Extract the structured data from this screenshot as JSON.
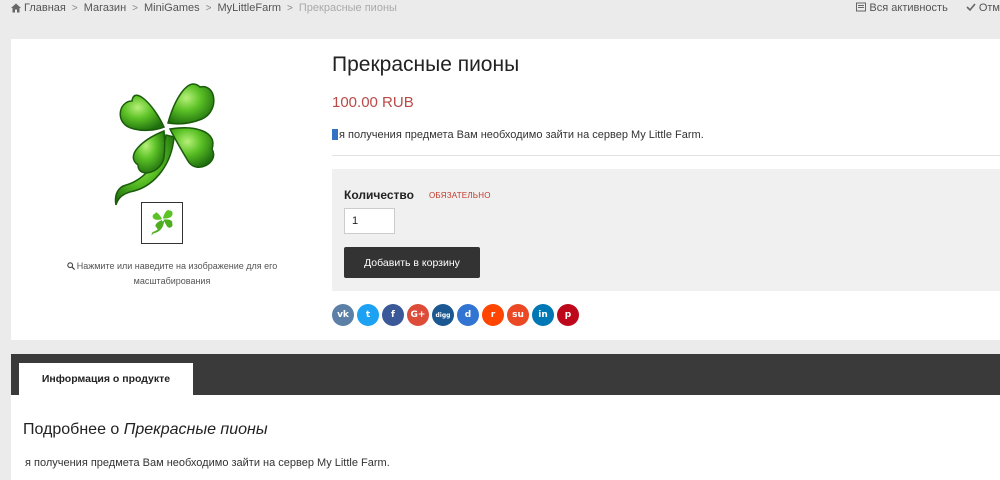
{
  "breadcrumb": {
    "items": [
      "Главная",
      "Магазин",
      "MiniGames",
      "MyLittleFarm",
      "Прекрасные пионы"
    ]
  },
  "top_actions": {
    "activity": "Вся активность",
    "mark": "Отм"
  },
  "product": {
    "title": "Прекрасные пионы",
    "price": "100.00 RUB",
    "description": "я получения предмета Вам необходимо зайти на сервер My Little Farm.",
    "image_icon": "clover-icon",
    "zoom_hint_line1": "Нажмите или наведите на изображение для его",
    "zoom_hint_line2": "масштабирования"
  },
  "options": {
    "quantity_label": "Количество",
    "required_label": "ОБЯЗАТЕЛЬНО",
    "quantity_value": "1",
    "add_to_cart": "Добавить в корзину"
  },
  "share_buttons": [
    {
      "name": "vk",
      "glyph": "vk",
      "color": "#5b7fa6"
    },
    {
      "name": "twitter",
      "glyph": "t",
      "color": "#1da1f2"
    },
    {
      "name": "facebook",
      "glyph": "f",
      "color": "#3b5998"
    },
    {
      "name": "google-plus",
      "glyph": "G+",
      "color": "#dd4b39"
    },
    {
      "name": "digg",
      "glyph": "digg",
      "color": "#1b5891"
    },
    {
      "name": "delicious",
      "glyph": "d",
      "color": "#3274d1"
    },
    {
      "name": "reddit",
      "glyph": "r",
      "color": "#ff4500"
    },
    {
      "name": "stumbleupon",
      "glyph": "su",
      "color": "#eb4924"
    },
    {
      "name": "linkedin",
      "glyph": "in",
      "color": "#0077b5"
    },
    {
      "name": "pinterest",
      "glyph": "p",
      "color": "#bd081c"
    }
  ],
  "tabs": {
    "info": "Информация о продукте"
  },
  "details": {
    "title_prefix": "Подробнее о ",
    "title_name": "Прекрасные пионы",
    "text": "я получения предмета Вам необходимо зайти на сервер My Little Farm."
  }
}
